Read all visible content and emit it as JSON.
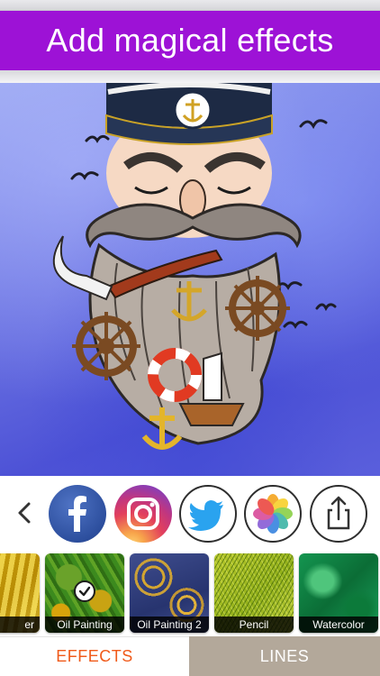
{
  "banner": {
    "title": "Add magical effects"
  },
  "share": {
    "items": [
      {
        "name": "facebook",
        "icon": "facebook-icon"
      },
      {
        "name": "instagram",
        "icon": "instagram-icon"
      },
      {
        "name": "twitter",
        "icon": "twitter-icon"
      },
      {
        "name": "photos",
        "icon": "photos-icon"
      },
      {
        "name": "share",
        "icon": "share-icon"
      }
    ]
  },
  "effects": {
    "items": [
      {
        "label": "er",
        "swatch": "amber"
      },
      {
        "label": "Oil Painting",
        "swatch": "oil",
        "selected": true
      },
      {
        "label": "Oil Painting 2",
        "swatch": "oil2"
      },
      {
        "label": "Pencil",
        "swatch": "pencil"
      },
      {
        "label": "Watercolor",
        "swatch": "water"
      }
    ]
  },
  "tabs": {
    "effects_label": "EFFECTS",
    "lines_label": "LINES",
    "active": "EFFECTS"
  },
  "colors": {
    "banner_bg": "#9d12d6",
    "active_tab_text": "#f05a1a",
    "inactive_tab_bg": "#b3a89a",
    "artwork_bg": "#5a5fdc"
  }
}
